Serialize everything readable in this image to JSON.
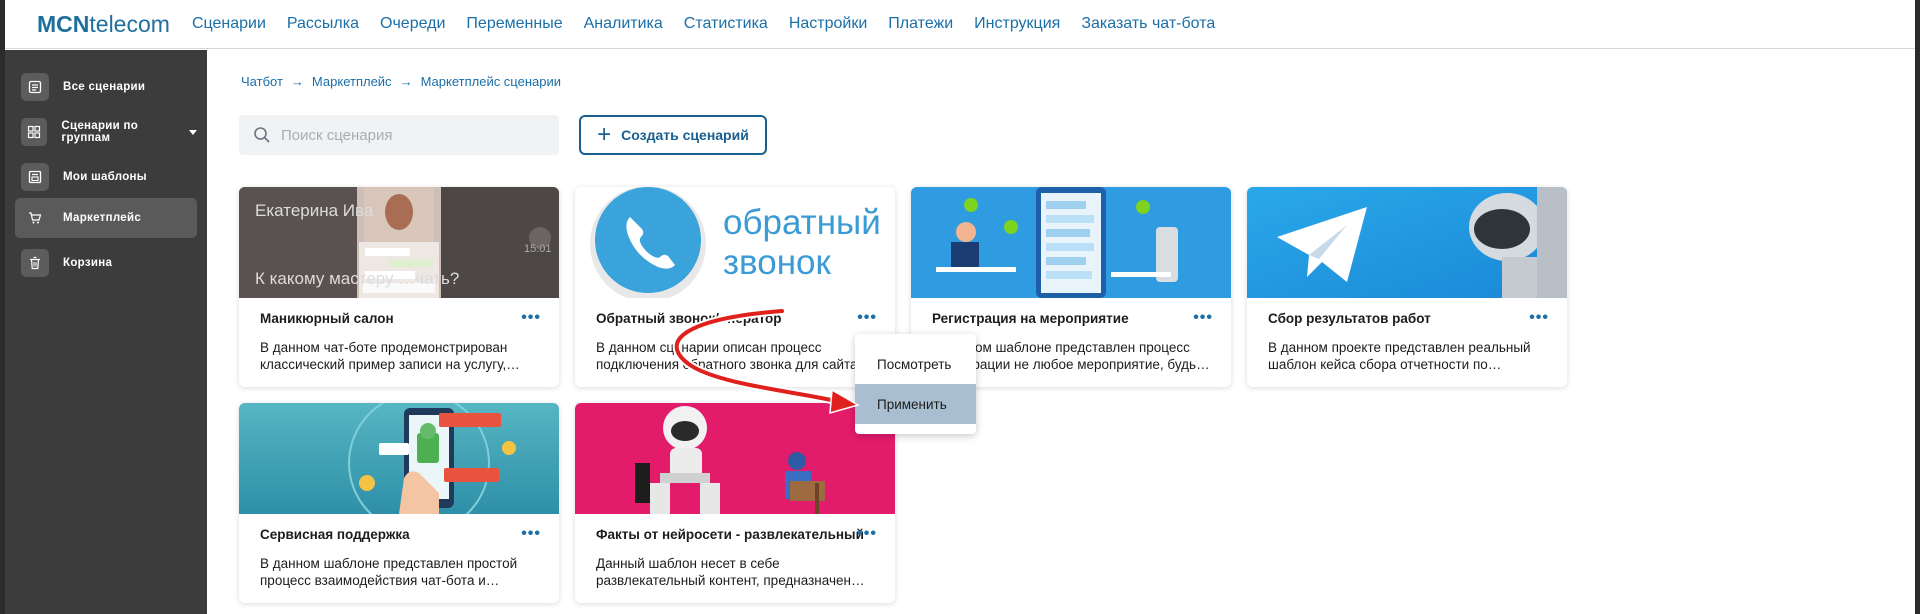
{
  "logo": {
    "brand": "MCN",
    "suffix": "telecom"
  },
  "topnav": [
    "Сценарии",
    "Рассылка",
    "Очереди",
    "Переменные",
    "Аналитика",
    "Статистика",
    "Настройки",
    "Платежи",
    "Инструкция",
    "Заказать чат-бота"
  ],
  "sidebar": {
    "items": [
      {
        "label": "Все сценарии",
        "icon": "list-icon"
      },
      {
        "label": "Сценарии по группам",
        "icon": "grid-icon"
      },
      {
        "label": "Мои шаблоны",
        "icon": "template-icon"
      },
      {
        "label": "Маркетплейс",
        "icon": "cart-icon"
      },
      {
        "label": "Корзина",
        "icon": "trash-icon"
      }
    ]
  },
  "breadcrumb": [
    "Чатбот",
    "Маркетплейс",
    "Маркетплейс сценарии"
  ],
  "search": {
    "placeholder": "Поиск сценария"
  },
  "create_button": "Создать сценарий",
  "cards": [
    {
      "title": "Маникюрный салон",
      "desc1": "В данном чат-боте продемонстрирован",
      "desc2": "классический пример записи на услугу,…",
      "image_text1": "Екатерина Ива",
      "image_text2": "К какому мастеру …чать?",
      "image_time": "15:01"
    },
    {
      "title": "Обратный звонок/оператор",
      "desc1": "В данном сценарии описан процесс",
      "desc2": "подключения обратного звонка для сайта…",
      "image_text1": "обратный",
      "image_text2": "звонок"
    },
    {
      "title": "Регистрация на мероприятие",
      "desc1": "В данном шаблоне представлен процесс",
      "desc2": "регистрации не любое мероприятие, будь…"
    },
    {
      "title": "Сбор результатов работ",
      "desc1": "В данном проекте представлен реальный",
      "desc2": "шаблон кейса сбора отчетности по…"
    },
    {
      "title": "Сервисная поддержка",
      "desc1": "В данном шаблоне представлен простой",
      "desc2": "процесс взаимодействия чат-бота и…"
    },
    {
      "title": "Факты от нейросети - развлекательный",
      "desc1": "Данный шаблон несет в себе",
      "desc2": "развлекательный контент, предназначен…"
    }
  ],
  "card_menu": [
    "Посмотреть",
    "Применить"
  ],
  "colors": {
    "brand": "#1f6f9c",
    "link": "#1a6fa8",
    "sidebar": "#3c3c3c",
    "menu_highlight": "#a9bed0",
    "arrow": "#e0201c"
  }
}
